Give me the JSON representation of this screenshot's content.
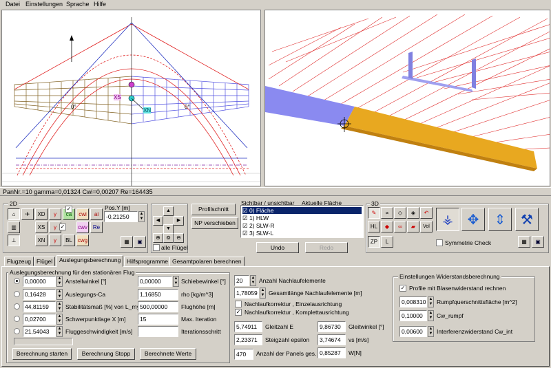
{
  "menu": {
    "items": [
      "Datei",
      "Einstellungen",
      "Sprache",
      "Hilfe"
    ]
  },
  "views": {
    "left_labels": [
      "XS",
      "XN",
      "0°",
      "0°"
    ]
  },
  "status": "PanNr.=10 gamma=0,01324 Cwi=0,00207 Re=164435",
  "panel2d": {
    "title": "2D",
    "tool_labels": [
      "XD",
      "ca",
      "cwi",
      "ai",
      "XS",
      "cwv",
      "Re",
      "XN",
      "BL",
      "cwg"
    ],
    "pos_label": "Pos.Y [m]",
    "pos_value": "-0,21250",
    "all_wings": "alle Flügel",
    "profile_btn": "Profilschnitt",
    "np_btn": "NP verschieben"
  },
  "visibility": {
    "title": "Sichtbar / unsichtbar",
    "current": "Aktuelle Fläche",
    "items": [
      "0) Fläche",
      "1) HLW",
      "2) SLW-R",
      "3) SLW-L"
    ],
    "undo": "Undo",
    "redo": "Redo"
  },
  "panel3d": {
    "title": "3D",
    "labels": [
      "HL",
      "Vol",
      "ZP",
      "L"
    ],
    "symmetry": "Symmetrie Check"
  },
  "tabs": [
    "Flugzeug",
    "Flügel",
    "Auslegungsberechnung",
    "Hilfsprogramme",
    "Gesamtpolaren berechnen"
  ],
  "design": {
    "group_title": "Auslegungsberechnung für den stationären Flug",
    "rows": [
      {
        "value": "0,00000",
        "label": "Anstellwinkel [°]"
      },
      {
        "value": "0,16428",
        "label": "Auslegungs-Ca"
      },
      {
        "value": "44,81159",
        "label": "Stabilitätsmaß [%] von L_my"
      },
      {
        "value": "0,02700",
        "label": "Schwerpunktlage X [m]"
      },
      {
        "value": "21,54043",
        "label": "Fluggeschwindigkeit [m/s]"
      }
    ],
    "right_rows": [
      {
        "value": "0,00000",
        "label": "Schiebewinkel [°]"
      },
      {
        "value": "1,16850",
        "label": "rho [kg/m^3]"
      },
      {
        "value": "500,00000",
        "label": "Flughöhe [m]"
      },
      {
        "value": "15",
        "label": "Max. Iteration"
      },
      {
        "value": "",
        "label": "Iterationsschritt"
      }
    ],
    "buttons": [
      "Berechnung starten",
      "Berechnung Stopp",
      "Berechnete Werte"
    ]
  },
  "wake": {
    "elements_value": "20",
    "elements_label": "Anzahl Nachlaufelemente",
    "length_value": "1,78059",
    "length_label": "Gesamtlänge Nachlaufelemente [m]",
    "corr1": "Nachlaufkorrektur , Einzelausrichtung",
    "corr2": "Nachlaufkorrektur , Komplettausrichtung",
    "results": [
      {
        "value": "5,74911",
        "label": "Gleitzahl E",
        "value2": "9,86730",
        "label2": "Gleitwinkel [°]"
      },
      {
        "value": "2,23371",
        "label": "Steigzahl epsilon",
        "value2": "3,74674",
        "label2": "vs [m/s]"
      },
      {
        "value": "470",
        "label": "Anzahl der Panels ges.",
        "value2": "0,85287",
        "label2": "W[N]"
      }
    ]
  },
  "drag": {
    "group_title": "Einstellungen Widerstandsberechnung",
    "bubble": "Profile mit Blasenwiderstand rechnen",
    "rows": [
      {
        "value": "0,008310",
        "label": "Rumpfquerschnittsfläche [m^2]"
      },
      {
        "value": "0,10000",
        "label": "Cw_rumpf"
      },
      {
        "value": "0,00600",
        "label": "Interferenzwiderstand Cw_int"
      }
    ]
  }
}
